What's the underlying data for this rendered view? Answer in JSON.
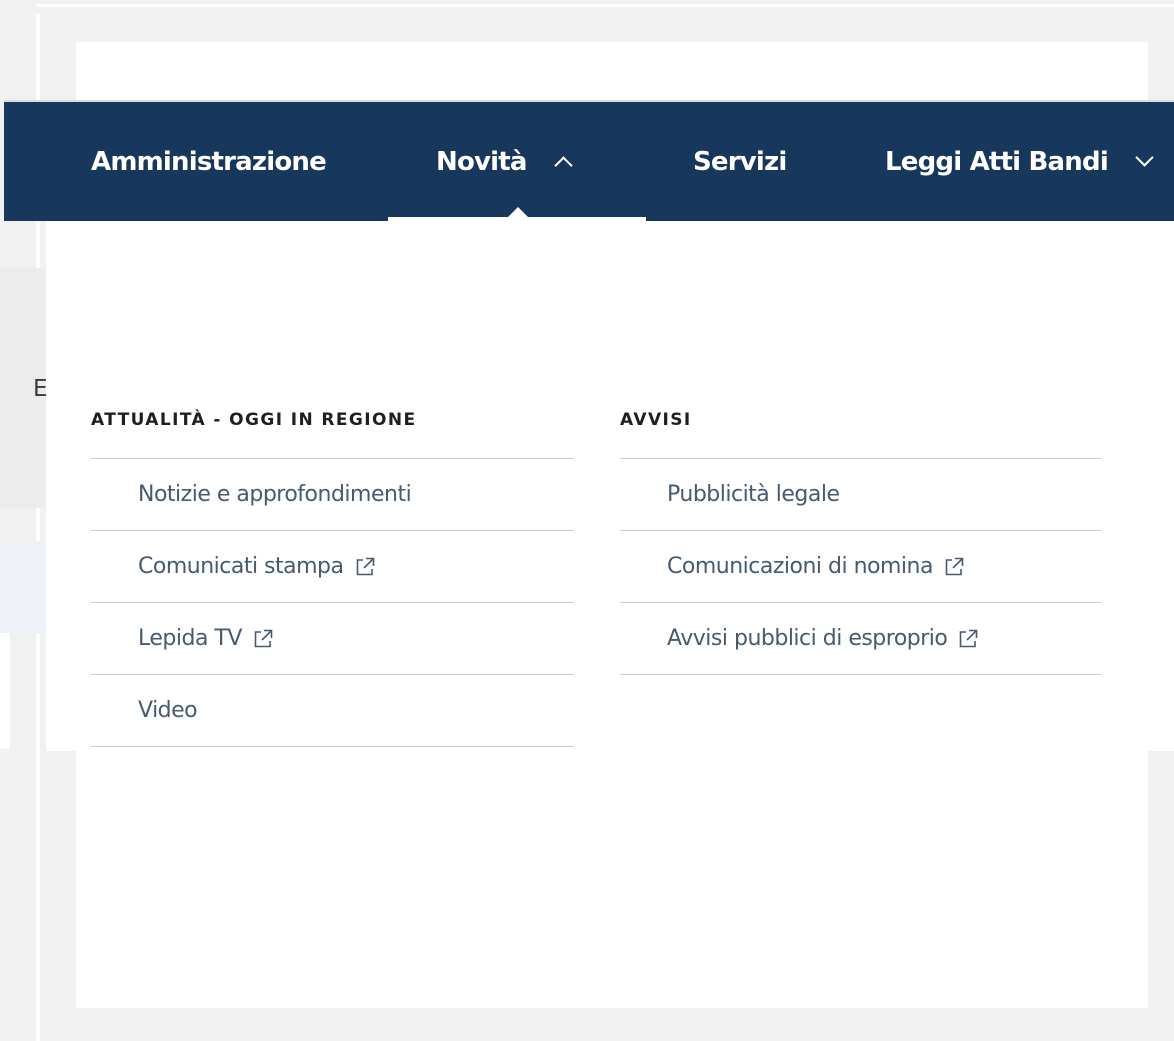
{
  "nav": {
    "items": [
      {
        "label": "Amministrazione"
      },
      {
        "label": "Novità",
        "chevron": "chevron-up-icon",
        "active": true
      },
      {
        "label": "Servizi"
      },
      {
        "label": "Leggi Atti Bandi",
        "chevron": "chevron-down-icon"
      }
    ]
  },
  "background": {
    "partial_letter": "E"
  },
  "dropdown": {
    "columns": [
      {
        "heading": "ATTUALITÀ - OGGI IN REGIONE",
        "links": [
          {
            "label": "Notizie e approfondimenti",
            "external": false
          },
          {
            "label": "Comunicati stampa",
            "external": true,
            "icon": "external-link-icon"
          },
          {
            "label": "Lepida TV",
            "external": true,
            "icon": "external-link-icon"
          },
          {
            "label": "Video",
            "external": false
          }
        ]
      },
      {
        "heading": "AVVISI",
        "links": [
          {
            "label": "Pubblicità legale",
            "external": false
          },
          {
            "label": "Comunicazioni di nomina",
            "external": true,
            "icon": "external-link-icon"
          },
          {
            "label": "Avvisi pubblici di esproprio",
            "external": true,
            "icon": "external-link-icon"
          }
        ]
      }
    ]
  },
  "colors": {
    "navbar_bg": "#17385c",
    "link_text": "#455b71",
    "heading_text": "#1c2024",
    "divider": "#c9ccd1",
    "page_bg": "#f1f1f1"
  }
}
